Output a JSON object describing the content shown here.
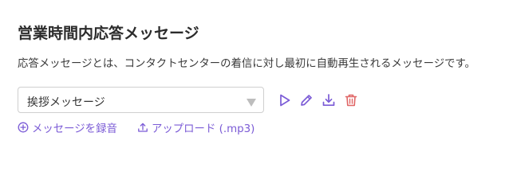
{
  "section": {
    "title": "営業時間内応答メッセージ",
    "description": "応答メッセージとは、コンタクトセンターの着信に対し最初に自動再生されるメッセージです。"
  },
  "message_select": {
    "selected": "挨拶メッセージ"
  },
  "actions": {
    "icons": [
      "play-icon",
      "edit-icon",
      "download-icon",
      "trash-icon"
    ]
  },
  "links": {
    "record": "メッセージを録音",
    "upload": "アップロード (.mp3)"
  },
  "colors": {
    "accent": "#7b5bd6",
    "danger": "#e06666"
  }
}
